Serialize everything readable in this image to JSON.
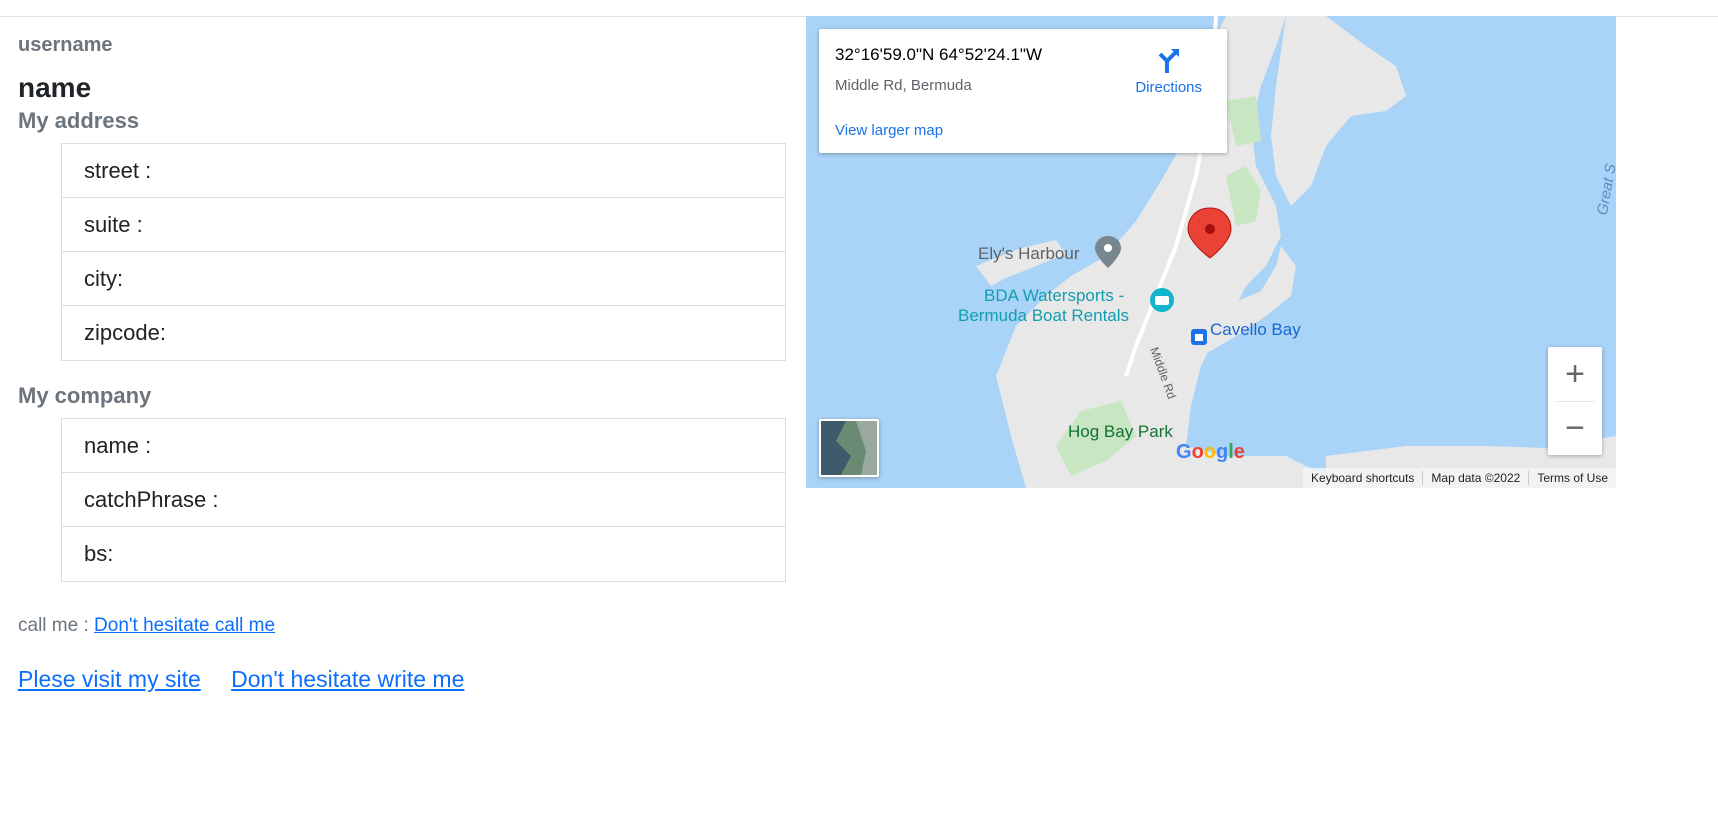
{
  "profile": {
    "username": "username",
    "name": "name"
  },
  "address": {
    "title": "My address",
    "items": [
      "street :",
      "suite :",
      "city:",
      "zipcode:"
    ]
  },
  "company": {
    "title": "My company",
    "items": [
      "name :",
      "catchPhrase :",
      "bs:"
    ]
  },
  "contact": {
    "call_label": "call me :",
    "call_link": "Don't hesitate call me",
    "site_link": "Plese visit my site",
    "write_link": "Don't hesitate write me"
  },
  "map": {
    "coordinates": "32°16'59.0\"N 64°52'24.1\"W",
    "address": "Middle Rd, Bermuda",
    "directions_label": "Directions",
    "view_larger": "View larger map",
    "labels": {
      "harbour": "Ely's Harbour",
      "watersports_line1": "BDA Watersports -",
      "watersports_line2": "Bermuda Boat Rentals",
      "cavello": "Cavello Bay",
      "park": "Hog Bay Park",
      "road": "Middle Rd",
      "great": "Great S"
    },
    "logo": "Google",
    "attribution": {
      "shortcuts": "Keyboard shortcuts",
      "data": "Map data ©2022",
      "terms": "Terms of Use"
    },
    "zoom_in": "+",
    "zoom_out": "−"
  },
  "colors": {
    "water": "#a9d3f7",
    "land": "#e8e8e8",
    "park": "#c9e6c2",
    "pin": "#ea4335",
    "link": "#0d6efd"
  }
}
